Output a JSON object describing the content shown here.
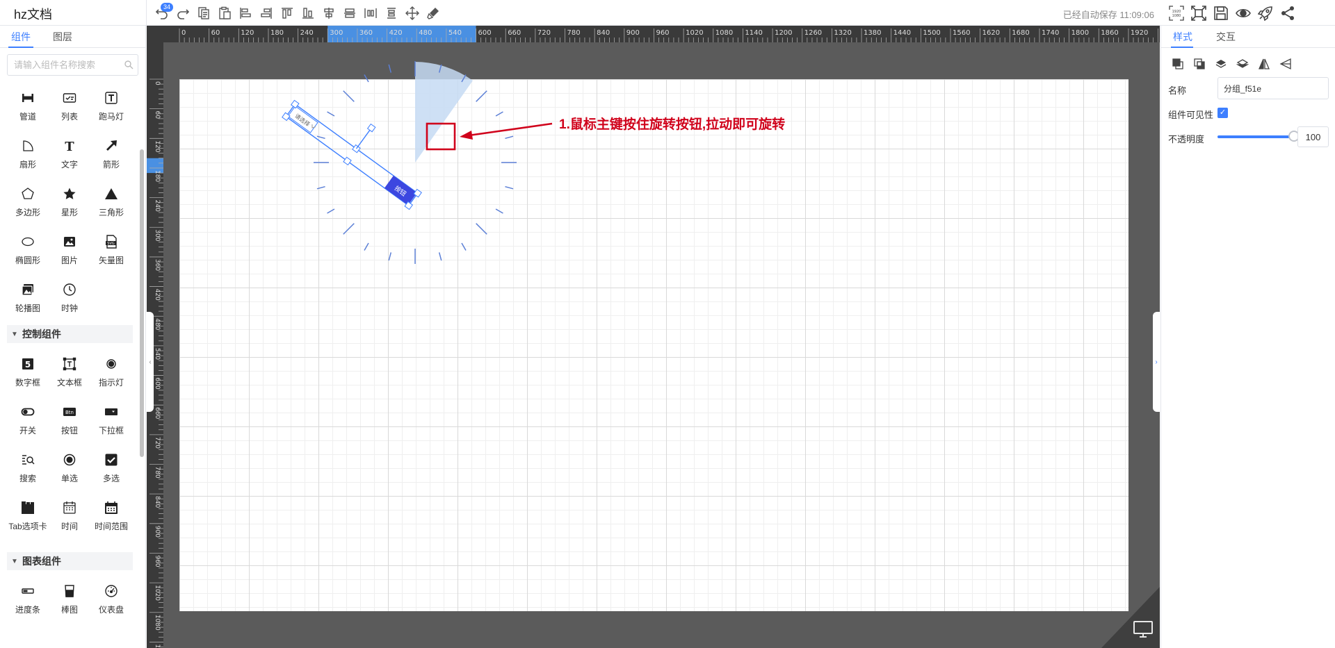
{
  "app": {
    "title": "hz文档"
  },
  "toolbar": {
    "undo_badge": "34",
    "buttons": [
      "undo",
      "redo",
      "copy",
      "paste",
      "align-left",
      "align-right",
      "align-top",
      "align-bottom",
      "align-h-center",
      "align-v-center",
      "distribute-h",
      "distribute-v",
      "move",
      "brush"
    ]
  },
  "status": {
    "autosave": "已经自动保存 11:09:06"
  },
  "right_tools": [
    "resolution-icon",
    "fit-screen-icon",
    "save-icon",
    "preview-icon",
    "publish-icon",
    "share-icon"
  ],
  "left_panel": {
    "tabs": [
      {
        "label": "组件",
        "active": true
      },
      {
        "label": "图层",
        "active": false
      }
    ],
    "search": {
      "placeholder": "请输入组件名称搜索",
      "value": ""
    },
    "basic_items": [
      {
        "label": "管道",
        "icon": "pipe-icon"
      },
      {
        "label": "列表",
        "icon": "list-icon"
      },
      {
        "label": "跑马灯",
        "icon": "marquee-icon"
      },
      {
        "label": "扇形",
        "icon": "sector-icon"
      },
      {
        "label": "文字",
        "icon": "text-icon"
      },
      {
        "label": "箭形",
        "icon": "arrow-icon"
      },
      {
        "label": "多边形",
        "icon": "polygon-icon"
      },
      {
        "label": "星形",
        "icon": "star-icon"
      },
      {
        "label": "三角形",
        "icon": "triangle-icon"
      },
      {
        "label": "椭圆形",
        "icon": "ellipse-icon"
      },
      {
        "label": "图片",
        "icon": "image-icon"
      },
      {
        "label": "矢量图",
        "icon": "svg-icon"
      },
      {
        "label": "轮播图",
        "icon": "carousel-icon"
      },
      {
        "label": "时钟",
        "icon": "clock-icon"
      }
    ],
    "control_section": {
      "title": "控制组件",
      "items": [
        {
          "label": "数字框",
          "icon": "number-box-icon"
        },
        {
          "label": "文本框",
          "icon": "textbox-icon"
        },
        {
          "label": "指示灯",
          "icon": "indicator-icon"
        },
        {
          "label": "开关",
          "icon": "switch-icon"
        },
        {
          "label": "按钮",
          "icon": "button-icon"
        },
        {
          "label": "下拉框",
          "icon": "dropdown-icon"
        },
        {
          "label": "搜索",
          "icon": "search-comp-icon"
        },
        {
          "label": "单选",
          "icon": "radio-icon"
        },
        {
          "label": "多选",
          "icon": "checkbox-icon"
        },
        {
          "label": "Tab选项卡",
          "icon": "tab-icon"
        },
        {
          "label": "时间",
          "icon": "time-icon"
        },
        {
          "label": "时间范围",
          "icon": "date-range-icon"
        }
      ]
    },
    "chart_section": {
      "title": "图表组件",
      "items": [
        {
          "label": "进度条",
          "icon": "progress-icon"
        },
        {
          "label": "棒图",
          "icon": "bar-gauge-icon"
        },
        {
          "label": "仪表盘",
          "icon": "gauge-icon"
        }
      ]
    }
  },
  "canvas": {
    "ruler_top_labels": [
      "0",
      "60",
      "120",
      "180",
      "240",
      "300",
      "360",
      "420",
      "480",
      "540",
      "600",
      "660",
      "720",
      "780",
      "840",
      "900",
      "960",
      "1020",
      "1080",
      "1140",
      "1200",
      "1260",
      "1320",
      "1380",
      "1440",
      "1500",
      "1560",
      "1620",
      "1680",
      "1740",
      "1800",
      "1860",
      "1920"
    ],
    "ruler_left_labels": [
      "0",
      "60",
      "120",
      "180",
      "240",
      "300",
      "360",
      "420",
      "480",
      "540",
      "600",
      "660",
      "720",
      "780",
      "840",
      "900",
      "960",
      "1020",
      "1080",
      "1140"
    ],
    "selection_texts": {
      "dropdown_placeholder": "请选择",
      "button_label": "按钮"
    },
    "annotation": "1.鼠标主键按住旋转按钮,拉动即可旋转",
    "colors": {
      "accent": "#3d7fff",
      "annotation": "#d0021b",
      "canvas_bg": "#5b5b5b"
    }
  },
  "right_panel": {
    "tabs": [
      {
        "label": "样式",
        "active": true
      },
      {
        "label": "交互",
        "active": false
      }
    ],
    "align_icons": [
      "bring-front-icon",
      "send-back-icon",
      "layer-up-icon",
      "layer-down-icon",
      "flip-h-icon",
      "flip-v-icon"
    ],
    "props": {
      "name_label": "名称",
      "name_value": "分组_f51e",
      "visible_label": "组件可见性",
      "visible": true,
      "opacity_label": "不透明度",
      "opacity_value": "100",
      "opacity_fraction": 1.0
    }
  }
}
